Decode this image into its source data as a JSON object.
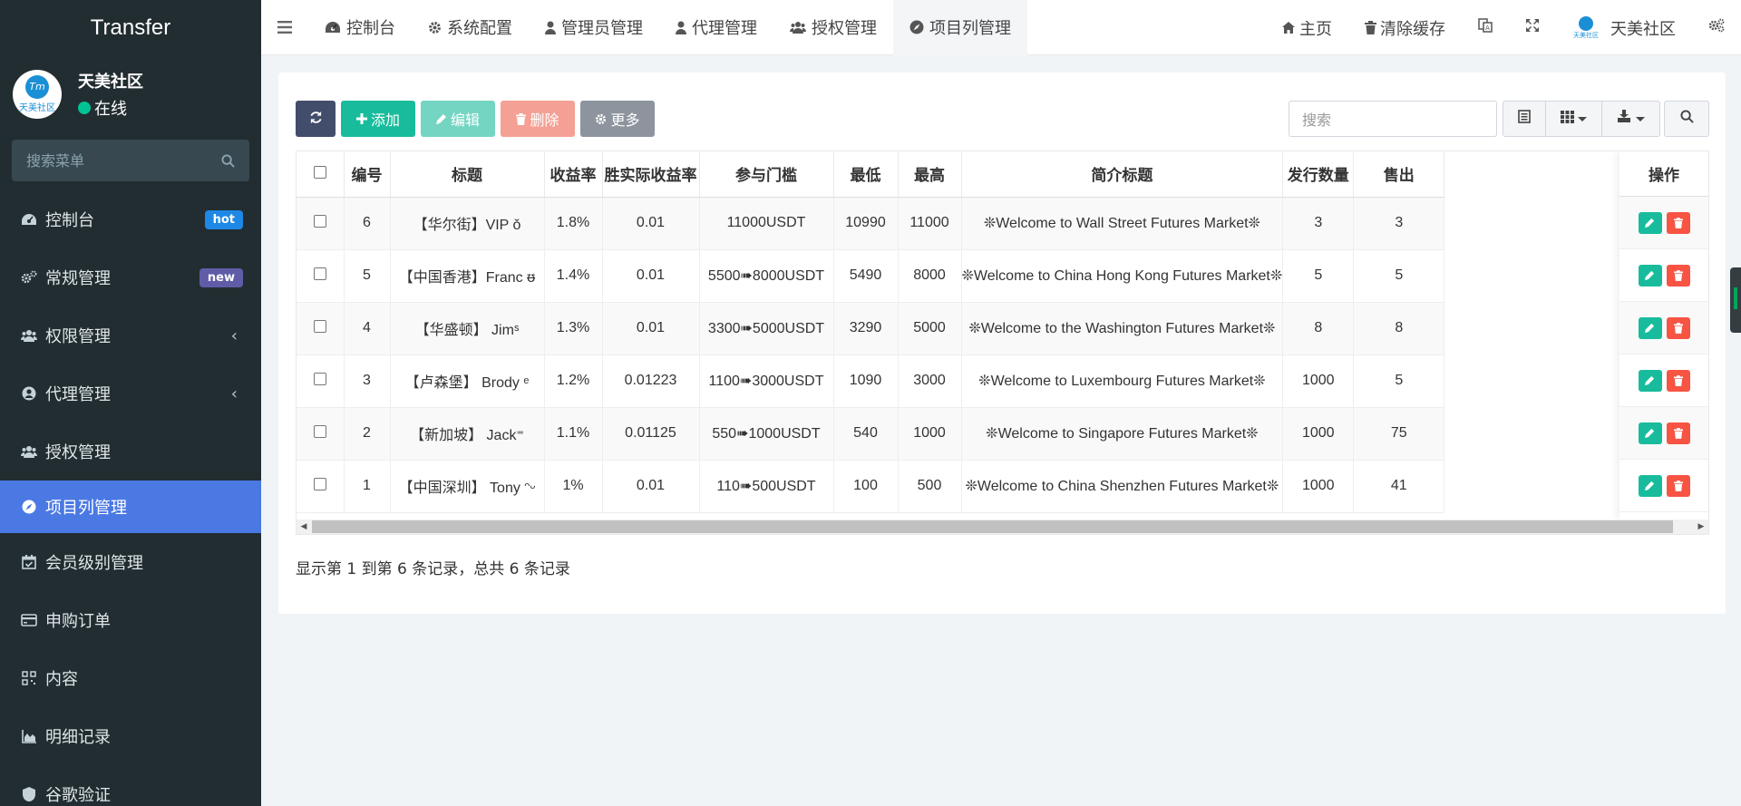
{
  "brand": {
    "title": "Transfer"
  },
  "user": {
    "name": "天美社区",
    "status": "在线",
    "logo_text": "天美社区",
    "logo_mark": "Tm"
  },
  "menu_search": {
    "placeholder": "搜索菜单"
  },
  "menu": [
    {
      "label": "控制台",
      "icon": "dashboard-icon",
      "badge": "hot"
    },
    {
      "label": "常规管理",
      "icon": "cogs-icon",
      "badge": "new"
    },
    {
      "label": "权限管理",
      "icon": "group-icon",
      "chevron": "‹"
    },
    {
      "label": "代理管理",
      "icon": "user-circle-icon",
      "chevron": "‹"
    },
    {
      "label": "授权管理",
      "icon": "group-icon"
    },
    {
      "label": "项目列管理",
      "icon": "compass-icon",
      "active": true
    },
    {
      "label": "会员级别管理",
      "icon": "calendar-check-icon"
    },
    {
      "label": "申购订单",
      "icon": "credit-card-icon"
    },
    {
      "label": "内容",
      "icon": "qrcode-icon"
    },
    {
      "label": "明细记录",
      "icon": "area-chart-icon"
    },
    {
      "label": "谷歌验证",
      "icon": "shield-icon"
    }
  ],
  "nav_tabs": [
    {
      "label": "控制台",
      "icon": "dashboard-icon"
    },
    {
      "label": "系统配置",
      "icon": "gear-icon"
    },
    {
      "label": "管理员管理",
      "icon": "user-icon"
    },
    {
      "label": "代理管理",
      "icon": "user-icon"
    },
    {
      "label": "授权管理",
      "icon": "group-icon"
    },
    {
      "label": "项目列管理",
      "icon": "compass-icon",
      "active": true
    }
  ],
  "top_right": {
    "home": "主页",
    "clear_cache": "清除缓存",
    "community": "天美社区"
  },
  "toolbar": {
    "add": "添加",
    "edit": "编辑",
    "delete": "删除",
    "more": "更多"
  },
  "search": {
    "placeholder": "搜索"
  },
  "table": {
    "headers": [
      "编号",
      "标题",
      "收益率",
      "胜实际收益率",
      "参与门槛",
      "最低",
      "最高",
      "简介标题",
      "发行数量",
      "售出"
    ],
    "ops_header": "操作",
    "rows": [
      [
        "6",
        "【华尔街】VIP ǒ",
        "1.8%",
        "0.01",
        "11000USDT",
        "10990",
        "11000",
        "❊Welcome to Wall Street Futures Market❊",
        "3",
        "3"
      ],
      [
        "5",
        "【中国香港】Franc ᵿ",
        "1.4%",
        "0.01",
        "5500➠8000USDT",
        "5490",
        "8000",
        "❊Welcome to China Hong Kong Futures Market❊",
        "5",
        "5"
      ],
      [
        "4",
        "【华盛顿】 Jimˢ",
        "1.3%",
        "0.01",
        "3300➠5000USDT",
        "3290",
        "5000",
        "❊Welcome to the Washington Futures Market❊",
        "8",
        "8"
      ],
      [
        "3",
        "【卢森堡】 Brody ᵉ",
        "1.2%",
        "0.01223",
        "1100➠3000USDT",
        "1090",
        "3000",
        "❊Welcome to Luxembourg Futures Market❊",
        "1000",
        "5"
      ],
      [
        "2",
        "【新加坡】 Jack⁼",
        "1.1%",
        "0.01125",
        "550➠1000USDT",
        "540",
        "1000",
        "❊Welcome to Singapore Futures Market❊",
        "1000",
        "75"
      ],
      [
        "1",
        "【中国深圳】 Tony ᵔᵕ",
        "1%",
        "0.01",
        "110➠500USDT",
        "100",
        "500",
        "❊Welcome to China Shenzhen Futures Market❊",
        "1000",
        "41"
      ]
    ]
  },
  "pagination": {
    "info": "显示第 1 到第 6 条记录，总共 6 条记录"
  },
  "colors": {
    "sidebar_bg": "#222d32",
    "active_menu": "#4b79e3",
    "add_green": "#18bc9c",
    "delete_red": "#f75444"
  }
}
